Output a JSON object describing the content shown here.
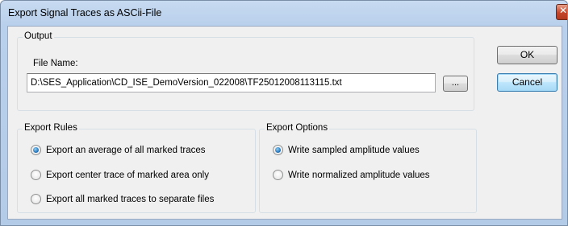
{
  "window": {
    "title": "Export Signal Traces as ASCii-File"
  },
  "output": {
    "caption": "Output",
    "file_name_label": "File Name:",
    "file_name_value": "D:\\SES_Application\\CD_ISE_DemoVersion_022008\\TF25012008113115.txt",
    "browse_label": "..."
  },
  "buttons": {
    "ok": "OK",
    "cancel": "Cancel"
  },
  "export_rules": {
    "caption": "Export Rules",
    "options": [
      {
        "label": "Export an average of all marked traces",
        "checked": true
      },
      {
        "label": "Export center trace of marked area only",
        "checked": false
      },
      {
        "label": "Export all marked traces to separate files",
        "checked": false
      }
    ]
  },
  "export_options": {
    "caption": "Export Options",
    "options": [
      {
        "label": "Write sampled amplitude values",
        "checked": true
      },
      {
        "label": "Write normalized amplitude values",
        "checked": false
      }
    ]
  },
  "colors": {
    "title_bar": "#b9d0ec",
    "dialog_face": "#f0f0f0",
    "close_button": "#c4452a",
    "default_button_border": "#3c7fb1"
  },
  "icons": {
    "close": "close-icon"
  }
}
